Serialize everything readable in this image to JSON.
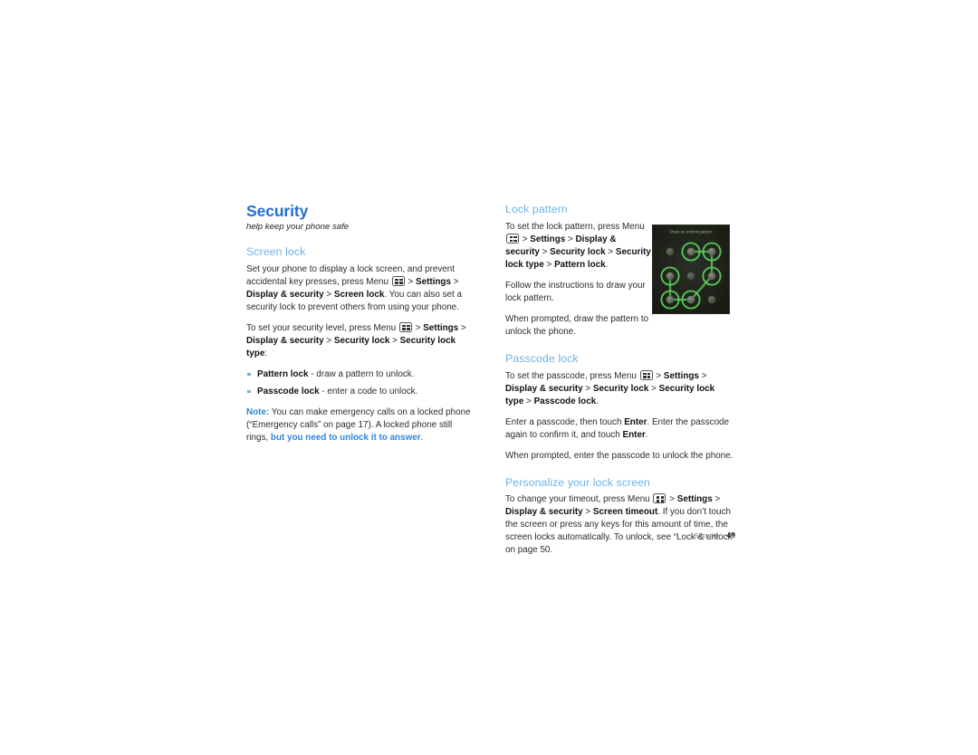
{
  "document": {
    "page_number": "49",
    "footer_chapter": "Security",
    "colors": {
      "title_blue": "#1f6fd0",
      "heading_blue": "#6fb3e8",
      "accent_blue": "#2e86de",
      "body_text": "#2b2b2b",
      "pattern_green": "#5fd35f"
    }
  },
  "left_column": {
    "title": "Security",
    "subtitle": "help keep your phone safe",
    "section_heading": "Screen lock",
    "para1": {
      "t1": "Set your phone to display a lock screen, and prevent accidental key presses, press Menu ",
      "icon": "menu-key-icon",
      "t2": " > ",
      "b1": "Settings",
      "t3": " > ",
      "b2": "Display & security",
      "t4": " > ",
      "b3": "Screen lock",
      "t5": ". You can also set a security lock to prevent others from using your phone."
    },
    "para2": {
      "t1": "To set your security level, press Menu ",
      "icon": "menu-key-icon",
      "t2": " > ",
      "b1": "Settings",
      "t3": " > ",
      "b2": "Display & security",
      "t4": " > ",
      "b3": "Security lock",
      "t5": " > ",
      "b4": "Security lock type",
      "t6": ":"
    },
    "bullets": [
      {
        "term": "Pattern lock",
        "desc": " - draw a pattern to unlock."
      },
      {
        "term": "Passcode lock",
        "desc": " - enter a code to unlock."
      }
    ],
    "note": {
      "label": "Note:",
      "t1": " You can make emergency calls on a locked phone (“Emergency calls” on page 17). A locked phone still rings, ",
      "highlight": "but you need to unlock it to answer",
      "t2": "."
    }
  },
  "right_column": {
    "lock_pattern": {
      "heading": "Lock pattern",
      "para1": {
        "t1": "To set the lock pattern, press Menu ",
        "icon": "menu-key-icon",
        "t2": " > ",
        "b1": "Settings",
        "t3": " > ",
        "b2": "Display & security",
        "t4": " > ",
        "b3": "Security lock",
        "t5": " > ",
        "b4": "Security lock type",
        "t6": " > ",
        "b5": "Pattern lock",
        "t7": "."
      },
      "para2": "Follow the instructions to draw your lock pattern.",
      "para3": "When prompted, draw the pattern to unlock the phone."
    },
    "passcode_lock": {
      "heading": "Passcode lock",
      "para1": {
        "t1": "To set the passcode, press Menu ",
        "icon": "menu-key-icon",
        "t2": " > ",
        "b1": "Settings",
        "t3": " > ",
        "b2": "Display & security",
        "t4": " > ",
        "b3": "Security lock",
        "t5": " > ",
        "b4": "Security lock type",
        "t6": " > ",
        "b5": "Passcode lock",
        "t7": "."
      },
      "para2": {
        "t1": "Enter a passcode, then touch ",
        "b1": "Enter",
        "t2": ". Enter the passcode again to confirm it, and touch ",
        "b2": "Enter",
        "t3": "."
      },
      "para3": "When prompted, enter the passcode to unlock the phone."
    },
    "personalize": {
      "heading": "Personalize your lock screen",
      "para1": {
        "t1": "To change your timeout, press Menu ",
        "icon": "menu-key-icon",
        "t2": " > ",
        "b1": "Settings",
        "t3": " > ",
        "b2": "Display & security",
        "t4": " > ",
        "b3": "Screen timeout",
        "t5": ". If you don’t touch the screen or press any keys for this amount of time, the screen locks automatically. To unlock, see “Lock & unlock” on page 50."
      }
    }
  },
  "figure": {
    "name": "unlock-pattern-screenshot",
    "caption": "Draw an unlock pattern",
    "background": "#1c1f1a",
    "dot_states": [
      [
        "off",
        "on",
        "on"
      ],
      [
        "on",
        "off",
        "on"
      ],
      [
        "on",
        "on",
        "off"
      ]
    ],
    "path_segments": [
      "r0c1-r0c2",
      "r0c2-r1c2",
      "r1c2-r2c1",
      "r2c1-r2c0",
      "r2c0-r1c0"
    ]
  }
}
